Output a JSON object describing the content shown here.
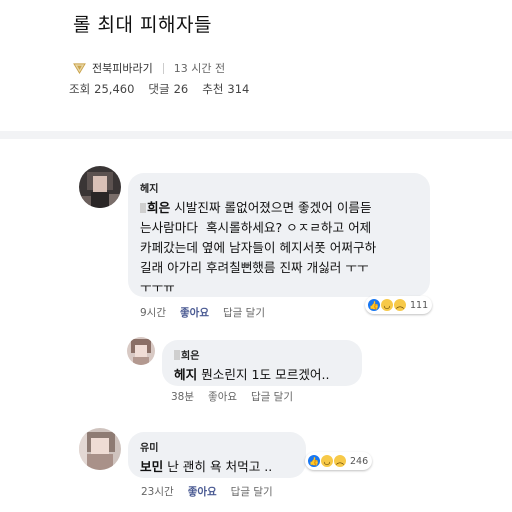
{
  "post": {
    "title": "롤 최대 피해자들",
    "board": "전북피바라기",
    "time": "13 시간 전",
    "views_label": "조회",
    "views": "25,460",
    "comments_label": "댓글",
    "comments": "26",
    "likes_label": "추천",
    "likes": "314"
  },
  "comments": [
    {
      "author": "헤지",
      "text_name": "희은",
      "text_rest": " 시발진짜 롤없어졌으면 좋겠어 이름듣\n는사람마다  혹시롤하세요? ㅇㅈㄹ하고 어제\n카페갔는데 옆에 남자들이 헤지서폿 어쩌구하\n길래 아가리 후려칠뻔했름 진짜 개싫러 ㅜㅜ\nㅜㅜㅠ",
      "time": "9시간",
      "like": "좋아요",
      "reply": "답글 달기",
      "reaction_count": "111"
    },
    {
      "author": "희은",
      "text_name": "헤지",
      "text_rest": " 뭔소린지 1도 모르겠어..",
      "time": "38분",
      "like": "좋아요",
      "reply": "답글 달기"
    },
    {
      "author": "유미",
      "text_name": "보민",
      "text_rest": " 난 괜히 욕 처먹고 ..",
      "time": "23시간",
      "like": "좋아요",
      "reply": "답글 달기",
      "reaction_count": "246"
    }
  ],
  "icons": {
    "board": "triangle-down-icon",
    "like": "thumbs-up-icon",
    "haha": "laugh-emoji-icon",
    "sad": "sad-emoji-icon"
  },
  "colors": {
    "like_text": "#4b5b93",
    "bubble": "#eff1f4",
    "board_icon": "#c9a24a"
  }
}
